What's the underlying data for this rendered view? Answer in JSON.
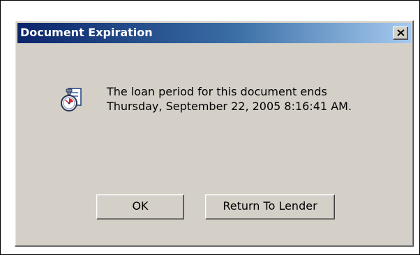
{
  "dialog": {
    "title": "Document Expiration",
    "message_line1": "The loan period for this document ends",
    "message_line2": "Thursday, September 22, 2005 8:16:41 AM.",
    "icon": "stopwatch-document-icon",
    "close_icon": "close-icon"
  },
  "buttons": {
    "ok_label": "OK",
    "return_label": "Return To Lender"
  },
  "colors": {
    "face": "#d4d0c8",
    "title_start": "#0a246a",
    "title_end": "#a6caf0",
    "title_text": "#ffffff"
  }
}
